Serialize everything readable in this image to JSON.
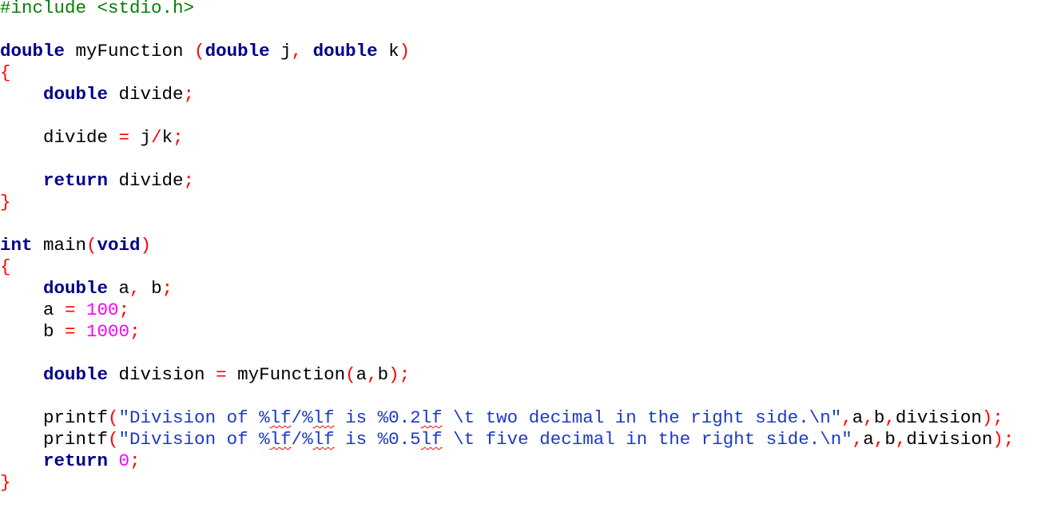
{
  "editor": {
    "language": "C",
    "colors": {
      "background": "#ffffff",
      "preprocessor": "#008000",
      "keyword": "#00008b",
      "identifier": "#000000",
      "operator": "#ff0000",
      "number": "#ff00ff",
      "string": "#1c39c8",
      "spellcheck_underline": "#ff0000"
    },
    "lines": [
      [
        [
          "pre",
          "#include <stdio.h>"
        ]
      ],
      [],
      [
        [
          "kw",
          "double"
        ],
        [
          "id",
          " myFunction "
        ],
        [
          "op",
          "("
        ],
        [
          "kw",
          "double"
        ],
        [
          "id",
          " j"
        ],
        [
          "op",
          ","
        ],
        [
          "id",
          " "
        ],
        [
          "kw",
          "double"
        ],
        [
          "id",
          " k"
        ],
        [
          "op",
          ")"
        ]
      ],
      [
        [
          "op",
          "{"
        ]
      ],
      [
        [
          "id",
          "    "
        ],
        [
          "kw",
          "double"
        ],
        [
          "id",
          " divide"
        ],
        [
          "op",
          ";"
        ]
      ],
      [],
      [
        [
          "id",
          "    divide "
        ],
        [
          "op",
          "="
        ],
        [
          "id",
          " j"
        ],
        [
          "op",
          "/"
        ],
        [
          "id",
          "k"
        ],
        [
          "op",
          ";"
        ]
      ],
      [],
      [
        [
          "id",
          "    "
        ],
        [
          "kw",
          "return"
        ],
        [
          "id",
          " divide"
        ],
        [
          "op",
          ";"
        ]
      ],
      [
        [
          "op",
          "}"
        ]
      ],
      [],
      [
        [
          "kw",
          "int"
        ],
        [
          "id",
          " main"
        ],
        [
          "op",
          "("
        ],
        [
          "kw",
          "void"
        ],
        [
          "op",
          ")"
        ]
      ],
      [
        [
          "op",
          "{"
        ]
      ],
      [
        [
          "id",
          "    "
        ],
        [
          "kw",
          "double"
        ],
        [
          "id",
          " a"
        ],
        [
          "op",
          ","
        ],
        [
          "id",
          " b"
        ],
        [
          "op",
          ";"
        ]
      ],
      [
        [
          "id",
          "    a "
        ],
        [
          "op",
          "="
        ],
        [
          "id",
          " "
        ],
        [
          "num",
          "100"
        ],
        [
          "op",
          ";"
        ]
      ],
      [
        [
          "id",
          "    b "
        ],
        [
          "op",
          "="
        ],
        [
          "id",
          " "
        ],
        [
          "num",
          "1000"
        ],
        [
          "op",
          ";"
        ]
      ],
      [],
      [
        [
          "id",
          "    "
        ],
        [
          "kw",
          "double"
        ],
        [
          "id",
          " division "
        ],
        [
          "op",
          "="
        ],
        [
          "id",
          " myFunction"
        ],
        [
          "op",
          "("
        ],
        [
          "id",
          "a"
        ],
        [
          "op",
          ","
        ],
        [
          "id",
          "b"
        ],
        [
          "op",
          ")"
        ],
        [
          "op",
          ";"
        ]
      ],
      [],
      [
        [
          "id",
          "    printf"
        ],
        [
          "op",
          "("
        ],
        [
          "str",
          "\"Division of %"
        ],
        [
          "str-sq",
          "lf"
        ],
        [
          "str",
          "/%"
        ],
        [
          "str-sq",
          "lf"
        ],
        [
          "str",
          " is %0.2"
        ],
        [
          "str-sq",
          "lf"
        ],
        [
          "str",
          " \\t two decimal in the right side.\\n\""
        ],
        [
          "op",
          ","
        ],
        [
          "id",
          "a"
        ],
        [
          "op",
          ","
        ],
        [
          "id",
          "b"
        ],
        [
          "op",
          ","
        ],
        [
          "id",
          "division"
        ],
        [
          "op",
          ")"
        ],
        [
          "op",
          ";"
        ]
      ],
      [
        [
          "id",
          "    printf"
        ],
        [
          "op",
          "("
        ],
        [
          "str",
          "\"Division of %"
        ],
        [
          "str-sq",
          "lf"
        ],
        [
          "str",
          "/%"
        ],
        [
          "str-sq",
          "lf"
        ],
        [
          "str",
          " is %0.5"
        ],
        [
          "str-sq",
          "lf"
        ],
        [
          "str",
          " \\t five decimal in the right side.\\n\""
        ],
        [
          "op",
          ","
        ],
        [
          "id",
          "a"
        ],
        [
          "op",
          ","
        ],
        [
          "id",
          "b"
        ],
        [
          "op",
          ","
        ],
        [
          "id",
          "division"
        ],
        [
          "op",
          ")"
        ],
        [
          "op",
          ";"
        ]
      ],
      [
        [
          "id",
          "    "
        ],
        [
          "kw",
          "return"
        ],
        [
          "id",
          " "
        ],
        [
          "num",
          "0"
        ],
        [
          "op",
          ";"
        ]
      ],
      [
        [
          "op",
          "}"
        ]
      ]
    ]
  }
}
